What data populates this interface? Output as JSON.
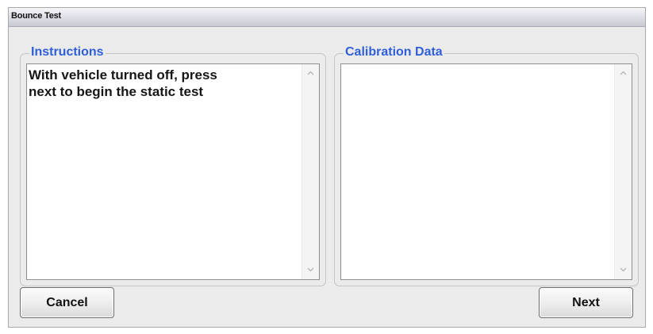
{
  "window": {
    "title": "Bounce Test"
  },
  "instructions": {
    "label": "Instructions",
    "text": "With vehicle turned off, press\nnext to begin the static test"
  },
  "calibration": {
    "label": "Calibration Data",
    "text": ""
  },
  "buttons": {
    "cancel_label": "Cancel",
    "next_label": "Next"
  },
  "icons": {
    "scroll_up": "chevron-up-icon",
    "scroll_down": "chevron-down-icon"
  },
  "colors": {
    "group_label": "#2f5fd8",
    "window_bg": "#ebebeb"
  }
}
